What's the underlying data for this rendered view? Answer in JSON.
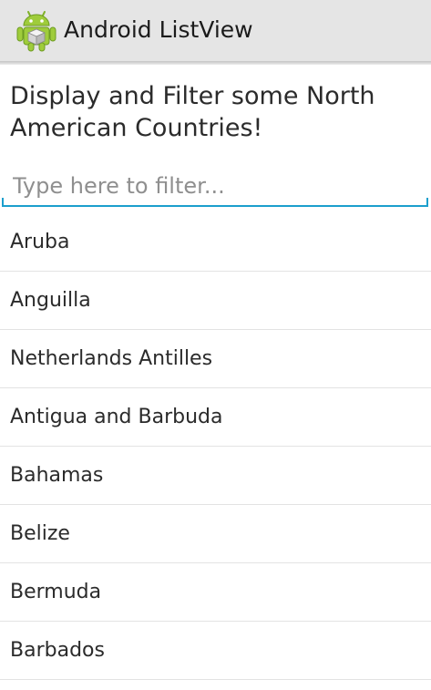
{
  "action_bar": {
    "title": "Android ListView",
    "icon": "android-icon"
  },
  "heading": "Display and Filter some North American Countries!",
  "filter": {
    "placeholder": "Type here to filter...",
    "value": "",
    "accent_color": "#1c9fcd"
  },
  "countries": [
    "Aruba",
    "Anguilla",
    "Netherlands Antilles",
    "Antigua and Barbuda",
    "Bahamas",
    "Belize",
    "Bermuda",
    "Barbados"
  ]
}
